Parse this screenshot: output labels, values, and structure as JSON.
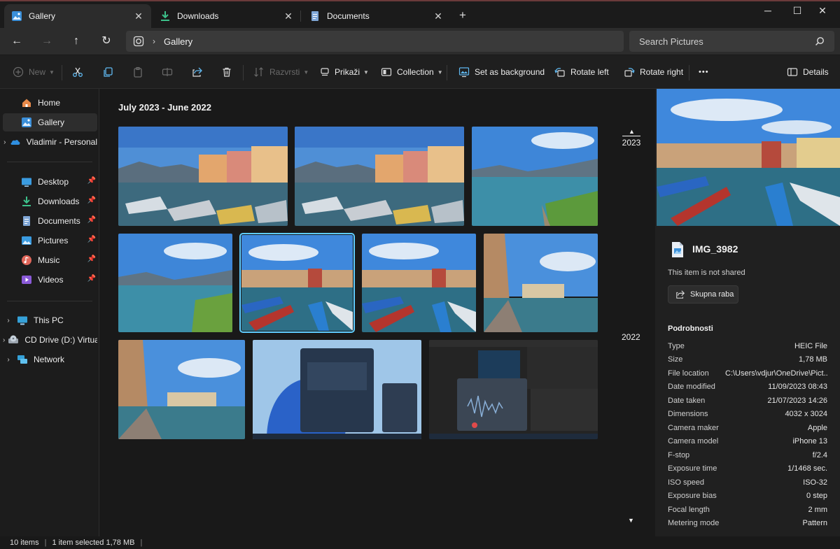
{
  "tabs": [
    {
      "label": "Gallery",
      "icon": "gallery-icon"
    },
    {
      "label": "Downloads",
      "icon": "download-icon"
    },
    {
      "label": "Documents",
      "icon": "document-icon"
    }
  ],
  "address": {
    "crumb": "Gallery",
    "search_placeholder": "Search Pictures"
  },
  "toolbar": {
    "new_label": "New",
    "rename_label": "Razvrsti",
    "view_label": "Prikaži",
    "collection_label": "Collection",
    "set_background_label": "Set as background",
    "rotate_left_label": "Rotate left",
    "rotate_right_label": "Rotate right",
    "more_label": "•••",
    "details_label": "Details"
  },
  "sidebar": {
    "items": [
      {
        "label": "Home",
        "icon": "home-icon"
      },
      {
        "label": "Gallery",
        "icon": "gallery-icon"
      },
      {
        "label": "Vladimir - Personal",
        "icon": "onedrive-icon"
      },
      {
        "label": "Desktop",
        "icon": "desktop-icon"
      },
      {
        "label": "Downloads",
        "icon": "download-icon"
      },
      {
        "label": "Documents",
        "icon": "document-icon"
      },
      {
        "label": "Pictures",
        "icon": "pictures-icon"
      },
      {
        "label": "Music",
        "icon": "music-icon"
      },
      {
        "label": "Videos",
        "icon": "video-icon"
      },
      {
        "label": "This PC",
        "icon": "pc-icon"
      },
      {
        "label": "CD Drive (D:) Virtua",
        "icon": "cd-drive-icon"
      },
      {
        "label": "Network",
        "icon": "network-icon"
      }
    ]
  },
  "gallery": {
    "group_title": "July 2023 - June 2022",
    "year_top": "2023",
    "year_mid": "2022"
  },
  "details": {
    "file_name": "IMG_3982",
    "shared_text": "This item is not shared",
    "share_button": "Skupna raba",
    "section_title": "Podrobnosti",
    "properties": [
      {
        "key": "Type",
        "value": "HEIC File"
      },
      {
        "key": "Size",
        "value": "1,78 MB"
      },
      {
        "key": "File location",
        "value": "C:\\Users\\vdjur\\OneDrive\\Pict..."
      },
      {
        "key": "Date modified",
        "value": "11/09/2023 08:43"
      },
      {
        "key": "Date taken",
        "value": "21/07/2023 14:26"
      },
      {
        "key": "Dimensions",
        "value": "4032 x 3024"
      },
      {
        "key": "Camera maker",
        "value": "Apple"
      },
      {
        "key": "Camera model",
        "value": "iPhone 13"
      },
      {
        "key": "F-stop",
        "value": "f/2.4"
      },
      {
        "key": "Exposure time",
        "value": "1/1468 sec."
      },
      {
        "key": "ISO speed",
        "value": "ISO-32"
      },
      {
        "key": "Exposure bias",
        "value": "0 step"
      },
      {
        "key": "Focal length",
        "value": "2 mm"
      },
      {
        "key": "Metering mode",
        "value": "Pattern"
      }
    ]
  },
  "status": {
    "items": "10 items",
    "selected": "1 item selected  1,78 MB"
  },
  "colors": {
    "accent": "#60cdff",
    "background": "#191919",
    "pane": "#202020"
  }
}
